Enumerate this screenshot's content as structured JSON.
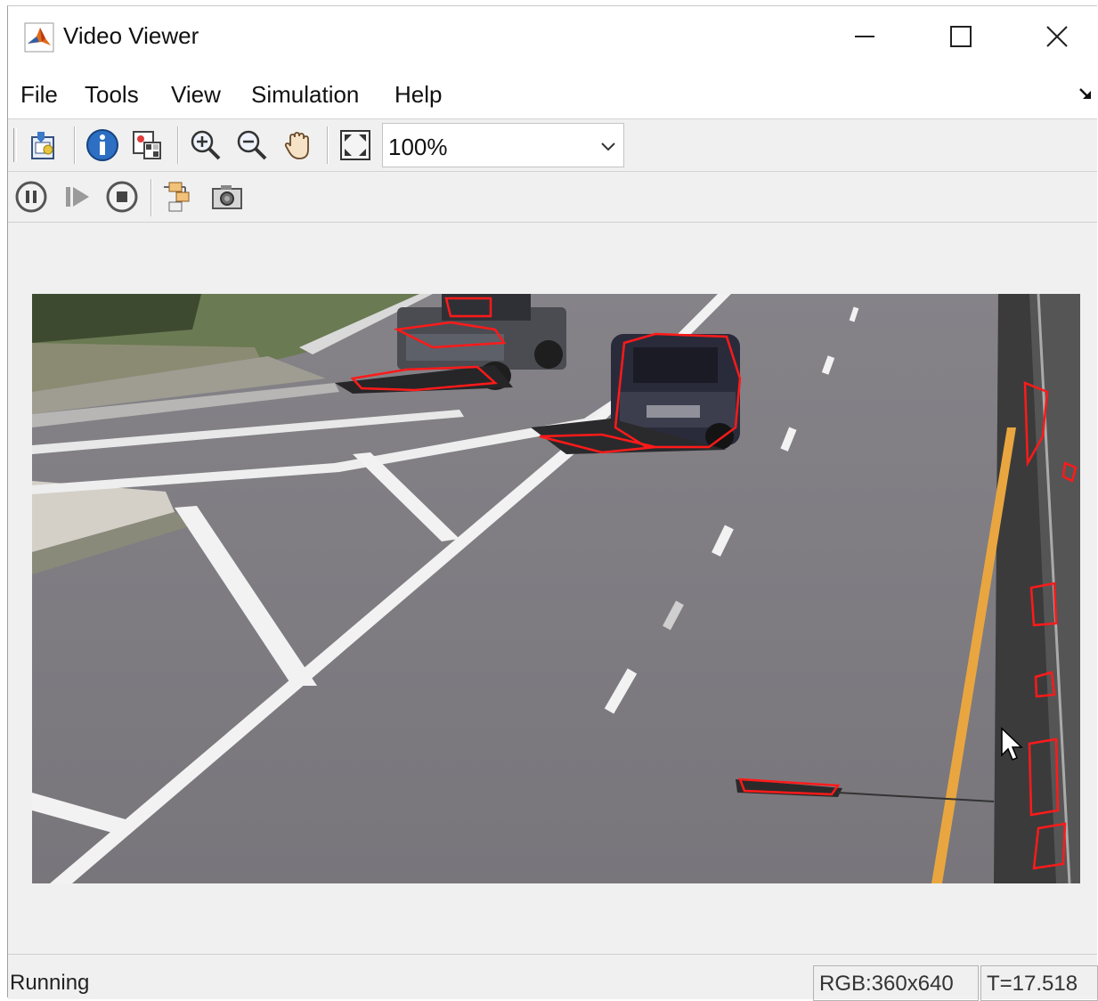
{
  "window": {
    "title": "Video Viewer",
    "app_icon": "matlab-logo-icon",
    "controls": {
      "minimize": "minimize-icon",
      "maximize": "maximize-icon",
      "close": "close-icon"
    }
  },
  "menu": {
    "items": [
      {
        "label": "File"
      },
      {
        "label": "Tools"
      },
      {
        "label": "View"
      },
      {
        "label": "Simulation"
      },
      {
        "label": "Help"
      }
    ],
    "dock_icon": "undock-arrow-icon"
  },
  "toolbar": {
    "buttons": [
      {
        "icon": "print-to-figure-icon"
      },
      {
        "icon": "info-icon"
      },
      {
        "icon": "pixel-region-icon"
      },
      {
        "icon": "zoom-in-icon"
      },
      {
        "icon": "zoom-out-icon"
      },
      {
        "icon": "pan-hand-icon"
      },
      {
        "icon": "fit-to-window-icon"
      }
    ],
    "zoom": {
      "value": "100%"
    }
  },
  "playback": {
    "buttons": [
      {
        "icon": "pause-icon"
      },
      {
        "icon": "step-forward-icon"
      },
      {
        "icon": "stop-icon"
      },
      {
        "icon": "highlight-simulink-signal-icon"
      },
      {
        "icon": "snapshot-camera-icon"
      }
    ]
  },
  "video": {
    "content": "video-frame",
    "colors": {
      "road": "#7e7c80",
      "lane_marking": "#f2f2f2",
      "edge_line": "#e9a640",
      "overlay": "#ff1a1a"
    }
  },
  "status": {
    "state": "Running",
    "resolution": "RGB:360x640",
    "time": "T=17.518"
  }
}
